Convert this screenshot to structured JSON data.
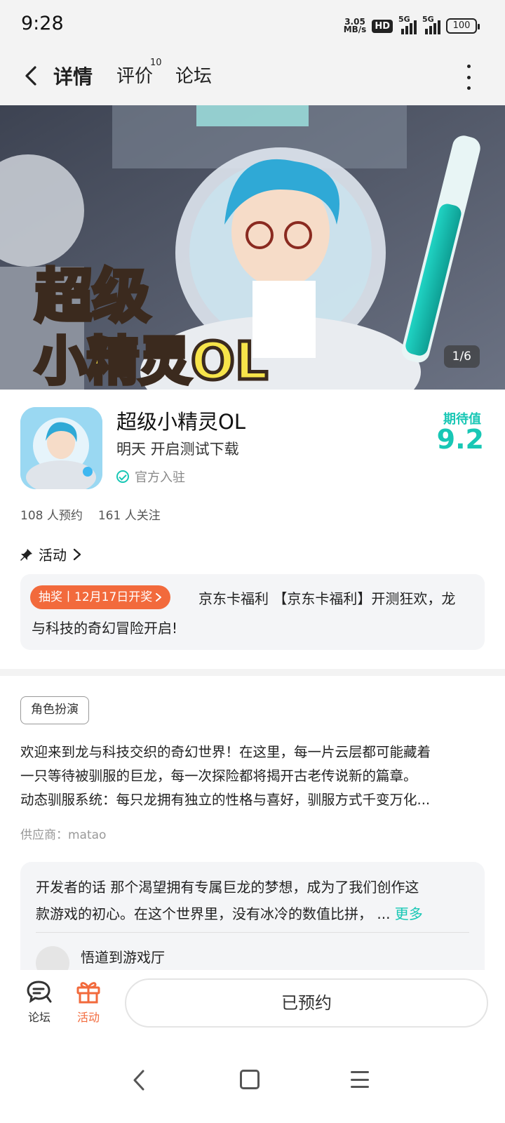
{
  "status_bar": {
    "time": "9:28",
    "net_speed_value": "3.05",
    "net_speed_unit": "MB/s",
    "hd_badge": "HD",
    "sim1_label": "5G",
    "sim2_label": "5G",
    "battery": "100"
  },
  "header": {
    "tabs": [
      {
        "label": "详情",
        "active": true
      },
      {
        "label": "评价",
        "badge": "10"
      },
      {
        "label": "论坛"
      }
    ]
  },
  "banner": {
    "counter": "1/6",
    "title_line1": "超级",
    "title_line2": "小精灵OL"
  },
  "app": {
    "title": "超级小精灵OL",
    "subtitle": "明天 开启测试下载",
    "official_label": "官方入驻",
    "expect_label": "期待值",
    "expect_score": "9.2"
  },
  "stats": {
    "reservations": "108 人预约",
    "followers": "161 人关注"
  },
  "activity": {
    "section_label": "活动",
    "tag": "抽奖丨12月17日开奖",
    "text_line1": "京东卡福利 【京东卡福利】开测狂欢，龙",
    "text_line2": "与科技的奇幻冒险开启!"
  },
  "genre_tag": "角色扮演",
  "description": {
    "line1": "欢迎来到龙与科技交织的奇幻世界！在这里，每一片云层都可能藏着",
    "line2": "一只等待被驯服的巨龙，每一次探险都将揭开古老传说新的篇章。",
    "line3": "动态驯服系统：每只龙拥有独立的性格与喜好，驯服方式千变万化..."
  },
  "supplier": "供应商：matao",
  "developer_note": {
    "line1": "开发者的话  那个渴望拥有专属巨龙的梦想，成为了我们创作这",
    "line2": "款游戏的初心。在这个世界里，没有冰冷的数值比拼， ...",
    "more": "更多",
    "author": "悟道到游戏厅"
  },
  "bottom_bar": {
    "forum_label": "论坛",
    "activity_label": "活动",
    "reserved_button": "已预约"
  },
  "colors": {
    "accent": "#18c7b5",
    "orange": "#f26a3c"
  }
}
